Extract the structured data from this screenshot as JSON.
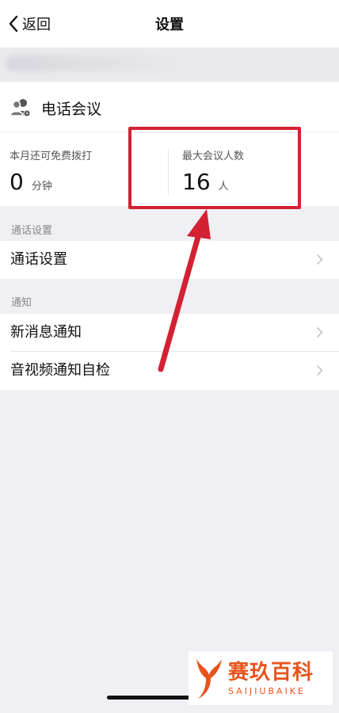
{
  "nav": {
    "back_label": "返回",
    "title": "设置"
  },
  "conference": {
    "title": "电话会议",
    "icon": "people-icon",
    "free_minutes_label": "本月还可免费拨打",
    "free_minutes_value": "0",
    "free_minutes_unit": "分钟",
    "max_participants_label": "最大会议人数",
    "max_participants_value": "16",
    "max_participants_unit": "人"
  },
  "sections": [
    {
      "header": "通话设置",
      "rows": [
        {
          "label": "通话设置"
        }
      ]
    },
    {
      "header": "通知",
      "rows": [
        {
          "label": "新消息通知"
        },
        {
          "label": "音视频通知自检"
        }
      ]
    }
  ],
  "annotation": {
    "color": "#d32133"
  },
  "watermark": {
    "brand_cn": "赛玖百科",
    "brand_en": "SAIJIUBAIKE",
    "color": "#e8541c"
  }
}
